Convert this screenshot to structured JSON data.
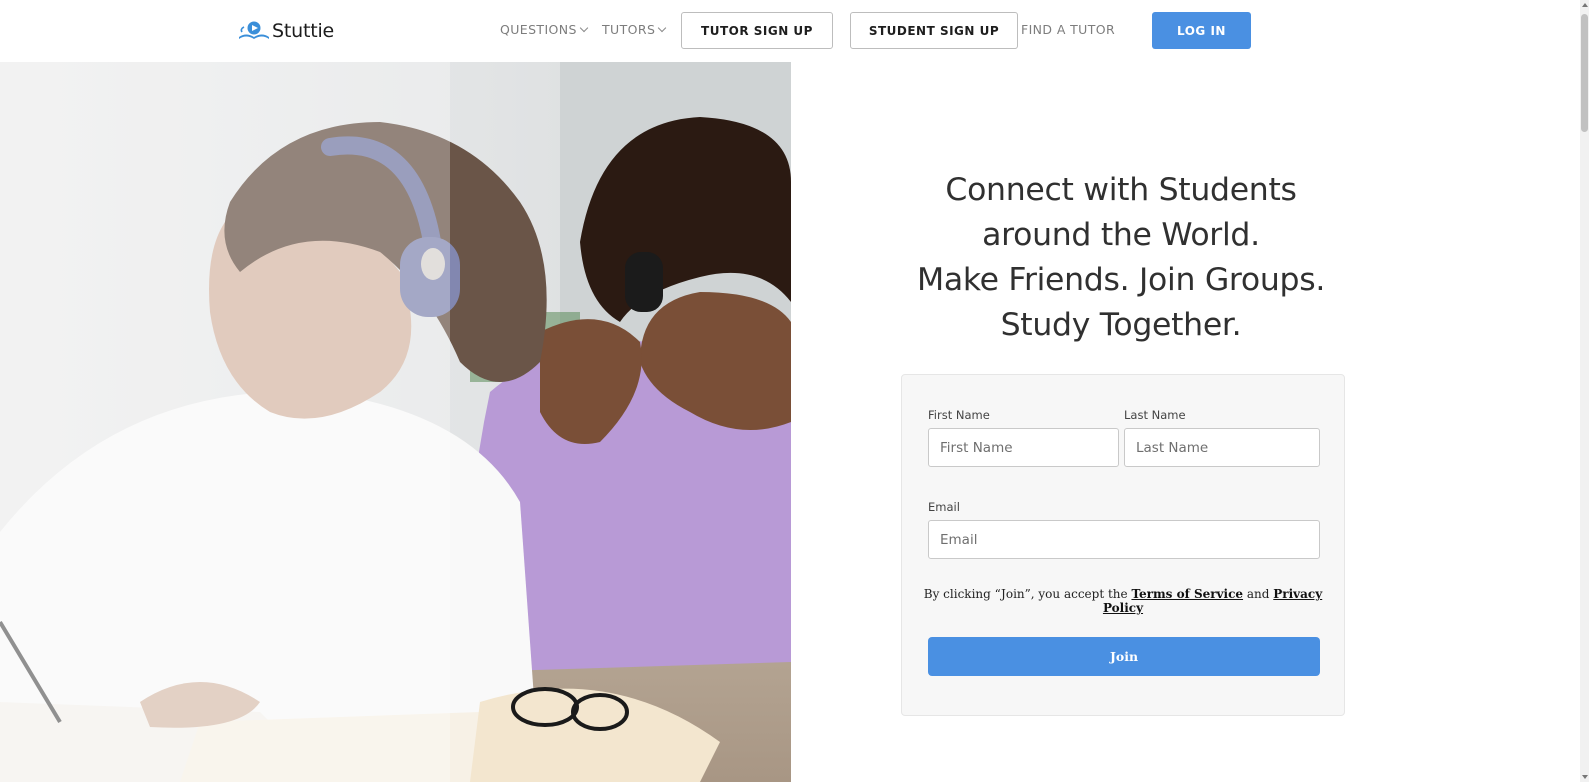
{
  "brand": {
    "name": "Stuttie",
    "logo_icon": "book-play-icon",
    "accent_color": "#4a90e2"
  },
  "nav": {
    "questions": "QUESTIONS",
    "tutors": "TUTORS",
    "tutor_signup": "TUTOR SIGN UP",
    "student_signup": "STUDENT SIGN UP",
    "find_tutor": "FIND A TUTOR",
    "login": "LOG IN"
  },
  "hero": {
    "image": "two-students-with-headphones-studying-photo",
    "headline_lines": [
      "Connect with Students",
      "around the World.",
      "Make Friends. Join Groups.",
      "Study Together."
    ]
  },
  "form": {
    "first_name_label": "First Name",
    "first_name_placeholder": "First Name",
    "first_name_value": "",
    "last_name_label": "Last Name",
    "last_name_placeholder": "Last Name",
    "last_name_value": "",
    "email_label": "Email",
    "email_placeholder": "Email",
    "email_value": "",
    "terms_prefix": "By clicking “Join”, you accept the",
    "terms_link": "Terms of Service",
    "terms_and": "and",
    "privacy_link": "Privacy Policy",
    "join_button": "Join"
  }
}
